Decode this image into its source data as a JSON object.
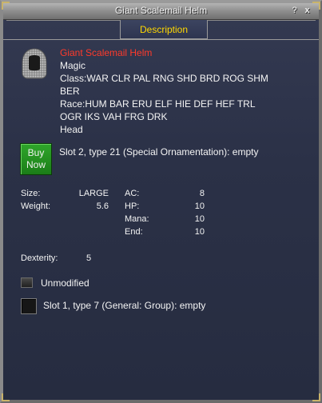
{
  "window": {
    "title": "Giant Scalemail Helm",
    "help_label": "?",
    "close_label": "x"
  },
  "tab": {
    "label": "Description"
  },
  "item": {
    "icon": "helm-icon",
    "name": "Giant Scalemail Helm",
    "name_color": "#ff3a2a",
    "type": "Magic",
    "class_line1": "Class:WAR CLR PAL RNG SHD BRD ROG SHM",
    "class_line2": "BER",
    "race_line1": "Race:HUM BAR ERU ELF HIE DEF HEF TRL",
    "race_line2": "OGR IKS VAH FRG DRK",
    "slot": "Head"
  },
  "buy_button": {
    "line1": "Buy",
    "line2": "Now",
    "color": "#2fa62b"
  },
  "ornament_slot": {
    "text": "Slot 2, type 21 (Special Ornamentation): empty"
  },
  "stats_left": [
    {
      "label": "Size:",
      "value": "LARGE"
    },
    {
      "label": "Weight:",
      "value": "5.6"
    }
  ],
  "stats_right": [
    {
      "label": "AC:",
      "value": "8"
    },
    {
      "label": "HP:",
      "value": "10"
    },
    {
      "label": "Mana:",
      "value": "10"
    },
    {
      "label": "End:",
      "value": "10"
    }
  ],
  "attributes": [
    {
      "label": "Dexterity:",
      "value": "5"
    }
  ],
  "unmodified": {
    "label": "Unmodified",
    "checked": false
  },
  "aug_slot": {
    "text": "Slot 1, type 7 (General: Group): empty"
  }
}
